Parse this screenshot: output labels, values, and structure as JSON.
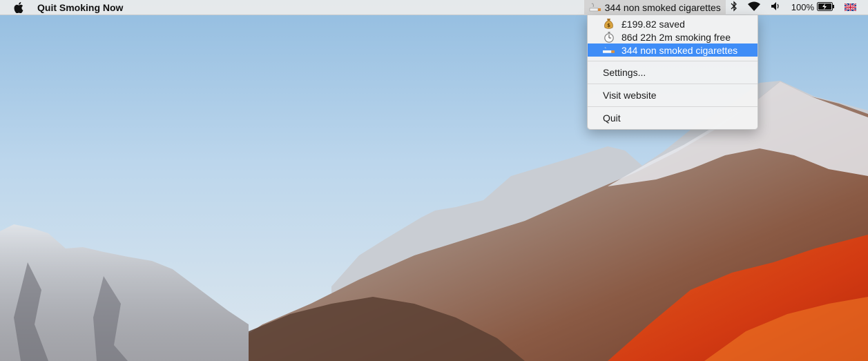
{
  "menubar": {
    "app_name": "Quit Smoking Now",
    "status_item_label": "344 non smoked cigarettes",
    "battery_percent": "100%",
    "icons": [
      "apple-icon",
      "cigarette-icon",
      "bluetooth-icon",
      "wifi-icon",
      "volume-icon",
      "battery-charging-icon",
      "uk-flag-icon"
    ]
  },
  "dropdown": {
    "stats": [
      {
        "icon": "money-bag-icon",
        "label": "£199.82 saved"
      },
      {
        "icon": "stopwatch-icon",
        "label": "86d 22h 2m smoking free"
      },
      {
        "icon": "cigarette-icon",
        "label": "344 non smoked cigarettes"
      }
    ],
    "settings_label": "Settings...",
    "website_label": "Visit website",
    "quit_label": "Quit"
  },
  "colors": {
    "menu_highlight": "#3f8df7",
    "menubar_bg": "#ececec"
  }
}
